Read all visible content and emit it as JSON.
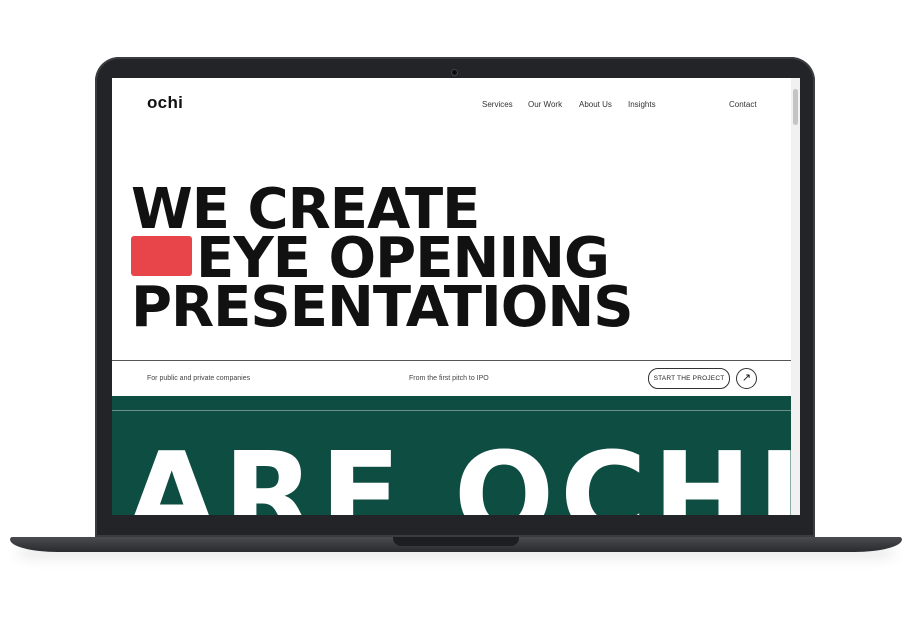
{
  "nav": {
    "logo": "ochi",
    "links": [
      "Services",
      "Our Work",
      "About Us",
      "Insights"
    ],
    "contact": "Contact"
  },
  "hero": {
    "lines": [
      "WE CREATE",
      "EYE OPENING",
      "PRESENTATIONS"
    ],
    "accent_color": "#e8454a"
  },
  "meta": {
    "left": "For public and private companies",
    "center": "From the first pitch to IPO",
    "cta_label": "START THE PROJECT"
  },
  "marquee": {
    "text": "ARE OCHI",
    "background": "#0d4d42"
  }
}
